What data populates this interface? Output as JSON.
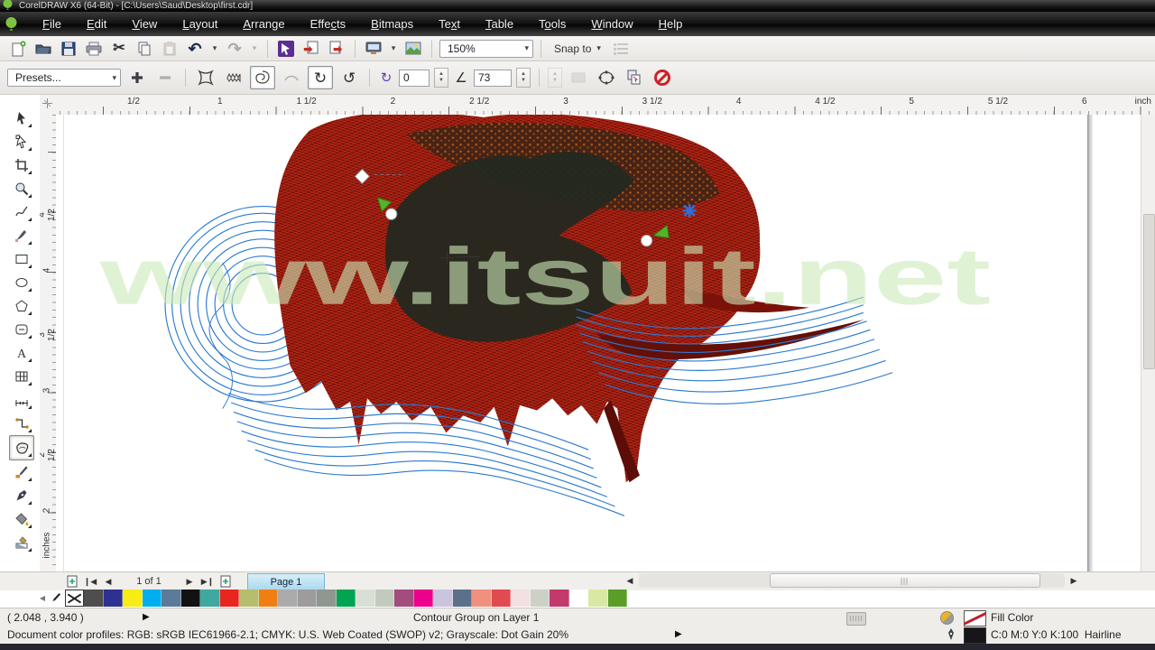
{
  "window": {
    "title": "CorelDRAW X6 (64-Bit) - [C:\\Users\\Saud\\Desktop\\first.cdr]"
  },
  "menubar": {
    "items": [
      {
        "pre": "",
        "key": "F",
        "post": "ile"
      },
      {
        "pre": "",
        "key": "E",
        "post": "dit"
      },
      {
        "pre": "",
        "key": "V",
        "post": "iew"
      },
      {
        "pre": "",
        "key": "L",
        "post": "ayout"
      },
      {
        "pre": "",
        "key": "A",
        "post": "rrange"
      },
      {
        "pre": "Effe",
        "key": "c",
        "post": "ts"
      },
      {
        "pre": "",
        "key": "B",
        "post": "itmaps"
      },
      {
        "pre": "Te",
        "key": "x",
        "post": "t"
      },
      {
        "pre": "",
        "key": "T",
        "post": "able"
      },
      {
        "pre": "T",
        "key": "o",
        "post": "ols"
      },
      {
        "pre": "",
        "key": "W",
        "post": "indow"
      },
      {
        "pre": "",
        "key": "H",
        "post": "elp"
      }
    ]
  },
  "toolbar": {
    "zoom_level": "150%",
    "snap_label": "Snap to",
    "icons": [
      "new-document-icon",
      "open-icon",
      "save-icon",
      "print-icon",
      "cut-icon",
      "copy-icon",
      "paste-icon",
      "undo-icon",
      "redo-icon",
      "application-launcher-icon",
      "import-icon",
      "export-icon",
      "welcome-screen-icon",
      "connect-icon",
      "options-icon"
    ]
  },
  "property_bar": {
    "presets_label": "Presets...",
    "complete_rotations": "0",
    "additional_degrees": "73",
    "icons": [
      "add-preset-icon",
      "remove-preset-icon",
      "push-pull-distortion-icon",
      "zipper-distortion-icon",
      "twister-distortion-icon",
      "smooth-distortion-icon",
      "rotate-cw-icon",
      "rotate-ccw-icon",
      "center-distortion-icon",
      "copy-distortion-icon",
      "clear-distortion-icon"
    ]
  },
  "rulers": {
    "horizontal_labels": [
      "1/2",
      "1",
      "1 1/2",
      "2",
      "2 1/2",
      "3",
      "3 1/2",
      "4",
      "4 1/2",
      "5",
      "5 1/2",
      "6"
    ],
    "horizontal_unit": "inch",
    "vertical_labels": [
      "4 1/2",
      "4",
      "3 1/2",
      "3",
      "2 1/2",
      "2"
    ],
    "vertical_unit": "inches"
  },
  "toolbox": {
    "tools": [
      "pick-tool",
      "shape-tool",
      "crop-tool",
      "zoom-tool",
      "freehand-tool",
      "artistic-media-tool",
      "rectangle-tool",
      "ellipse-tool",
      "polygon-tool",
      "basic-shapes-tool",
      "text-tool",
      "table-tool",
      "parallel-dimension-tool",
      "straight-line-connector-tool",
      "distort-tool",
      "color-eyedropper-tool",
      "outline-pen-tool",
      "fill-tool",
      "interactive-fill-tool"
    ],
    "selected_tool": "distort-tool"
  },
  "canvas": {
    "watermark": "www.itsuit.net"
  },
  "page_nav": {
    "page_indicator": "1 of 1",
    "page_tab": "Page 1"
  },
  "palette": {
    "colors": [
      "#4e4e4e",
      "#2e3192",
      "#f7ec13",
      "#00aeef",
      "#5c7a99",
      "#121212",
      "#3fa8a0",
      "#e8251f",
      "#b7bd6e",
      "#f07f13",
      "#ababab",
      "#9c9c9c",
      "#8f9790",
      "#00a551",
      "#dadfd6",
      "#c2cabe",
      "#a14e7c",
      "#ec008c",
      "#cac4de",
      "#5c7089",
      "#f0907e",
      "#e04a50",
      "#f3e0e2",
      "#ccd1c5",
      "#c23a6c",
      "#ffffff",
      "#d9e8a2",
      "#5a9e28"
    ]
  },
  "status_bar": {
    "cursor_position": "( 2.048 , 3.940 )",
    "selection_info": "Contour Group on Layer 1",
    "fill_label": "Fill Color",
    "outline_value": "C:0 M:0 Y:0 K:100",
    "outline_width": "Hairline",
    "profiles": "Document color profiles: RGB: sRGB IEC61966-2.1; CMYK: U.S. Web Coated (SWOP) v2; Grayscale: Dot Gain 20%"
  },
  "accent_colors": {
    "artwork_red": "#a81a10",
    "artwork_dark": "#232820",
    "artwork_blue": "#2b7ad0",
    "watermark_green": "#cdeab8",
    "page_tab_blue": "#a8d8ee"
  }
}
